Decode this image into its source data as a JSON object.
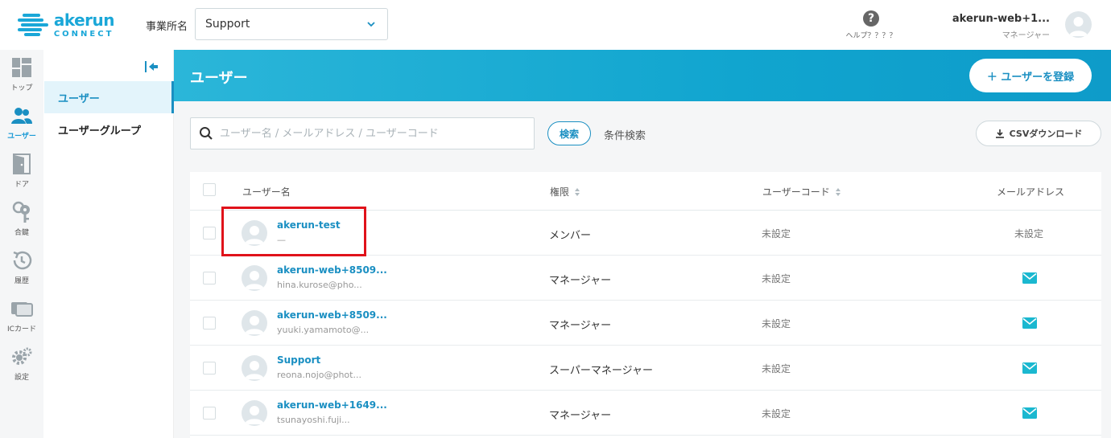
{
  "header": {
    "logo_main": "akerun",
    "logo_sub": "CONNECT",
    "office_label": "事業所名",
    "office_value": "Support",
    "help_label": "ヘルプ？？？？",
    "help_icon": "question-circle-icon",
    "user_name": "akerun-web+1...",
    "user_role": "マネージャー"
  },
  "leftnav": [
    {
      "label": "トップ",
      "icon": "dashboard-icon"
    },
    {
      "label": "ユーザー",
      "icon": "users-icon"
    },
    {
      "label": "ドア",
      "icon": "door-icon"
    },
    {
      "label": "合鍵",
      "icon": "keys-icon"
    },
    {
      "label": "履歴",
      "icon": "history-icon"
    },
    {
      "label": "ICカード",
      "icon": "ic-card-icon"
    },
    {
      "label": "設定",
      "icon": "gear-icon"
    }
  ],
  "subnav": {
    "items": [
      {
        "label": "ユーザー"
      },
      {
        "label": "ユーザーグループ"
      }
    ]
  },
  "page": {
    "title": "ユーザー",
    "add_button": "＋ ユーザーを登録",
    "search_placeholder": "ユーザー名 / メールアドレス / ユーザーコード",
    "search_button": "検索",
    "advanced_search": "条件検索",
    "csv_button": "CSVダウンロード"
  },
  "table": {
    "columns": [
      "ユーザー名",
      "権限",
      "ユーザーコード",
      "メールアドレス"
    ],
    "rows": [
      {
        "name": "akerun-test",
        "sub": "—",
        "role": "メンバー",
        "code": "未設定",
        "mail": "未設定"
      },
      {
        "name": "akerun-web+8509...",
        "sub": "hina.kurose@pho...",
        "role": "マネージャー",
        "code": "未設定",
        "mail": ""
      },
      {
        "name": "akerun-web+8509...",
        "sub": "yuuki.yamamoto@...",
        "role": "マネージャー",
        "code": "未設定",
        "mail": ""
      },
      {
        "name": "Support",
        "sub": "reona.nojo@phot...",
        "role": "スーパーマネージャー",
        "code": "未設定",
        "mail": ""
      },
      {
        "name": "akerun-web+1649...",
        "sub": "tsunayoshi.fuji...",
        "role": "マネージャー",
        "code": "未設定",
        "mail": ""
      }
    ]
  },
  "colors": {
    "accent": "#1a8fc2",
    "banner": "#11a5cf",
    "highlight": "#e0121a"
  }
}
